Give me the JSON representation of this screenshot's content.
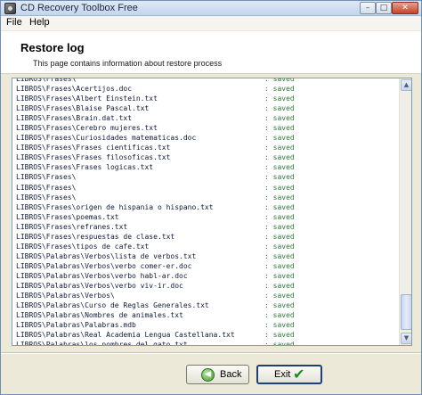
{
  "window": {
    "title": "CD Recovery Toolbox Free",
    "controls": {
      "minimize": "–",
      "maximize": "□",
      "close": "✕"
    }
  },
  "menu": {
    "file": "File",
    "help": "Help"
  },
  "header": {
    "title": "Restore log",
    "subtitle": "This page contains information about restore process"
  },
  "log": {
    "status_column": ": saved",
    "entries": [
      "LIBROS\\Frases\\",
      "LIBROS\\Frases\\Acertijos.doc",
      "LIBROS\\Frases\\Albert Einstein.txt",
      "LIBROS\\Frases\\Blaise Pascal.txt",
      "LIBROS\\Frases\\Brain.dat.txt",
      "LIBROS\\Frases\\Cerebro mujeres.txt",
      "LIBROS\\Frases\\Curiosidades matematicas.doc",
      "LIBROS\\Frases\\Frases cientificas.txt",
      "LIBROS\\Frases\\Frases filosoficas.txt",
      "LIBROS\\Frases\\Frases logicas.txt",
      "LIBROS\\Frases\\",
      "LIBROS\\Frases\\",
      "LIBROS\\Frases\\",
      "LIBROS\\Frases\\origen de hispania o hispano.txt",
      "LIBROS\\Frases\\poemas.txt",
      "LIBROS\\Frases\\refranes.txt",
      "LIBROS\\Frases\\respuestas de clase.txt",
      "LIBROS\\Frases\\tipos de cafe.txt",
      "LIBROS\\Palabras\\Verbos\\lista de verbos.txt",
      "LIBROS\\Palabras\\Verbos\\verbo comer-er.doc",
      "LIBROS\\Palabras\\Verbos\\verbo habl-ar.doc",
      "LIBROS\\Palabras\\Verbos\\verbo viv-ir.doc",
      "LIBROS\\Palabras\\Verbos\\",
      "LIBROS\\Palabras\\Curso de Reglas Generales.txt",
      "LIBROS\\Palabras\\Nombres de animales.txt",
      "LIBROS\\Palabras\\Palabras.mdb",
      "LIBROS\\Palabras\\Real Academia Lengua Castellana.txt",
      "LIBROS\\Palabras\\los nombres del gato.txt"
    ]
  },
  "scrollbar": {
    "up_arrow": "▲",
    "down_arrow": "▼"
  },
  "buttons": {
    "back_label": "Back",
    "back_icon": "◀",
    "exit_label": "Exit",
    "exit_icon": "✔"
  },
  "colors": {
    "status_green": "#2e7a3c",
    "path_text": "#0d1b38",
    "panel_border": "#7f9db9"
  }
}
